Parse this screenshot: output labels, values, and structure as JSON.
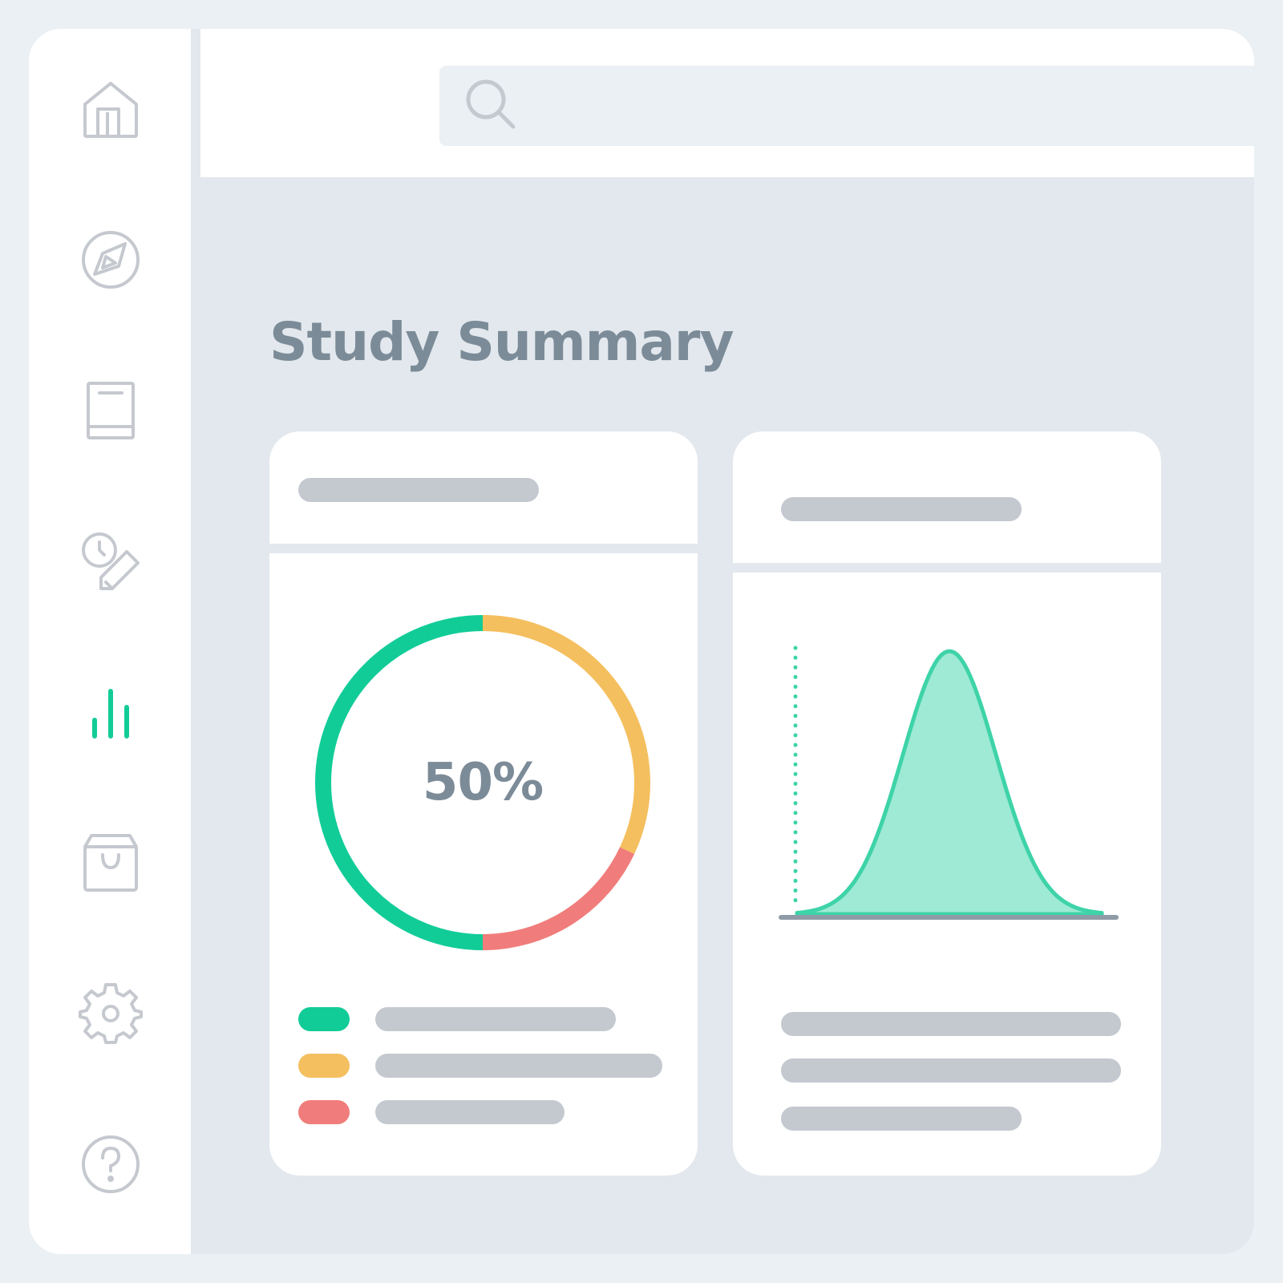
{
  "sidebar": {
    "items": [
      {
        "icon": "home-icon",
        "active": false
      },
      {
        "icon": "compass-icon",
        "active": false
      },
      {
        "icon": "book-icon",
        "active": false
      },
      {
        "icon": "schedule-edit-icon",
        "active": false
      },
      {
        "icon": "bar-chart-icon",
        "active": true
      },
      {
        "icon": "shopping-bag-icon",
        "active": false
      },
      {
        "icon": "gear-icon",
        "active": false
      },
      {
        "icon": "help-icon",
        "active": false
      }
    ]
  },
  "search": {
    "icon": "search-icon",
    "value": "",
    "placeholder": ""
  },
  "main": {
    "title": "Study Summary"
  },
  "colors": {
    "green": "#12cc98",
    "yellow": "#f4bf5e",
    "red": "#f07d7b",
    "mint_fill": "#9eead5",
    "mint_stroke": "#3ed3a8",
    "inactive_icon": "#c5c9cf",
    "title_text": "#7c8b98",
    "placeholder_bar": "#c4c9d0"
  },
  "donut_card": {
    "center_label": "50%",
    "legend": [
      {
        "color": "#12cc98"
      },
      {
        "color": "#f4bf5e"
      },
      {
        "color": "#f07d7b"
      }
    ]
  },
  "chart_data": [
    {
      "type": "pie",
      "variant": "donut",
      "center_label": "50%",
      "slices": [
        {
          "color": "#12cc98",
          "value": 50
        },
        {
          "color": "#f4bf5e",
          "value": 32
        },
        {
          "color": "#f07d7b",
          "value": 18
        }
      ]
    },
    {
      "type": "area",
      "shape": "bell-curve",
      "title": "",
      "xlabel": "",
      "ylabel": "",
      "color_fill": "#9eead5",
      "color_stroke": "#3ed3a8",
      "marker_line": "dotted vertical line at left tail"
    }
  ]
}
